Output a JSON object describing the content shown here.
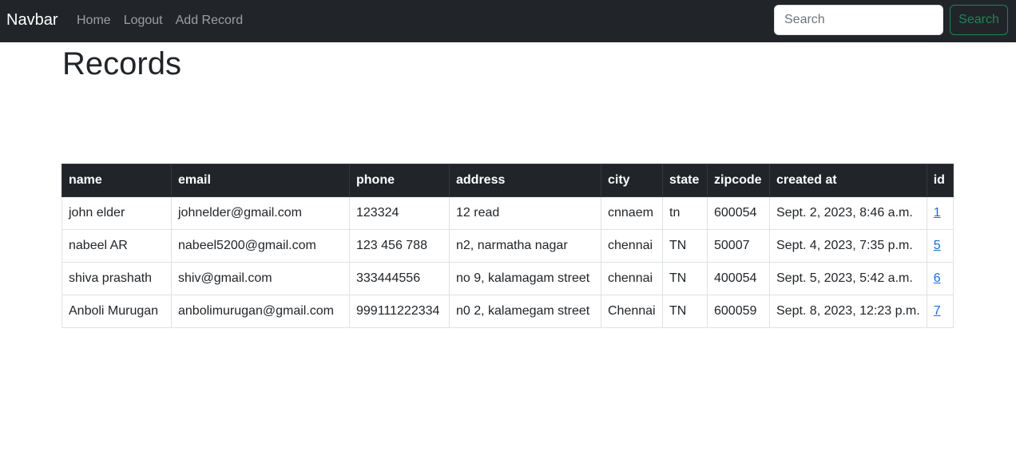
{
  "navbar": {
    "brand": "Navbar",
    "links": [
      "Home",
      "Logout",
      "Add Record"
    ],
    "search_placeholder": "Search",
    "search_button": "Search"
  },
  "page": {
    "title": "Records"
  },
  "table": {
    "headers": [
      "name",
      "email",
      "phone",
      "address",
      "city",
      "state",
      "zipcode",
      "created at",
      "id"
    ],
    "rows": [
      [
        "john elder",
        "johnelder@gmail.com",
        "123324",
        "12 read",
        "cnnaem",
        "tn",
        "600054",
        "Sept. 2, 2023, 8:46 a.m.",
        "1"
      ],
      [
        "nabeel AR",
        "nabeel5200@gmail.com",
        "123 456 788",
        "n2, narmatha nagar",
        "chennai",
        "TN",
        "50007",
        "Sept. 4, 2023, 7:35 p.m.",
        "5"
      ],
      [
        "shiva prashath",
        "shiv@gmail.com",
        "333444556",
        "no 9, kalamagam street",
        "chennai",
        "TN",
        "400054",
        "Sept. 5, 2023, 5:42 a.m.",
        "6"
      ],
      [
        "Anboli Murugan",
        "anbolimurugan@gmail.com",
        "999111222334",
        "n0 2, kalamegam street",
        "Chennai",
        "TN",
        "600059",
        "Sept. 8, 2023, 12:23 p.m.",
        "7"
      ]
    ]
  },
  "colors": {
    "navbar_bg": "#212529",
    "search_button": "#198754",
    "link": "#0d6efd"
  }
}
